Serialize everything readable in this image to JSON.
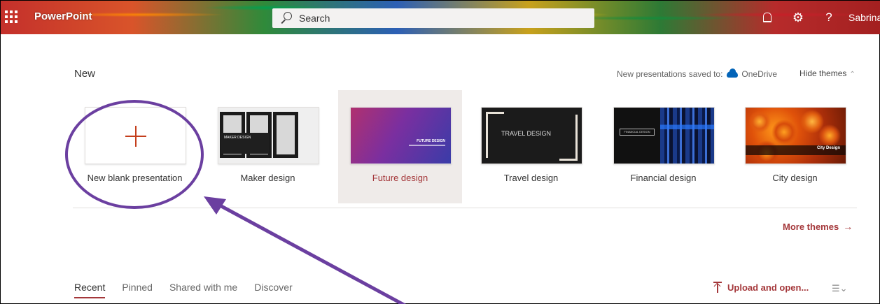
{
  "app": {
    "name": "PowerPoint"
  },
  "search": {
    "placeholder": "Search"
  },
  "header": {
    "user": "Sabrina I"
  },
  "new_section": {
    "title": "New",
    "saved_to_label": "New presentations saved to:",
    "saved_to_location": "OneDrive",
    "hide_themes": "Hide themes",
    "templates": [
      {
        "label": "New blank presentation"
      },
      {
        "label": "Maker design",
        "thumb_text": "MAKER DESIGN"
      },
      {
        "label": "Future design",
        "thumb_text": "FUTURE DESIGN"
      },
      {
        "label": "Travel design",
        "thumb_text": "TRAVEL DESIGN"
      },
      {
        "label": "Financial design",
        "thumb_text": "FINANCIAL DESIGN"
      },
      {
        "label": "City design",
        "thumb_text": "City Design"
      }
    ],
    "more_themes": "More themes"
  },
  "files": {
    "tabs": [
      "Recent",
      "Pinned",
      "Shared with me",
      "Discover"
    ],
    "active_tab": "Recent",
    "upload": "Upload and open..."
  },
  "colors": {
    "accent": "#a4373a",
    "annotation": "#6b3fa0",
    "onedrive": "#0364b8"
  },
  "icons": {
    "waffle": "app-launcher-icon",
    "search": "search-icon",
    "bell": "bell-icon",
    "gear": "gear-icon",
    "help": "help-icon",
    "cloud": "cloud-icon",
    "plus": "plus-icon",
    "upload": "upload-icon",
    "sort": "sort-icon"
  }
}
